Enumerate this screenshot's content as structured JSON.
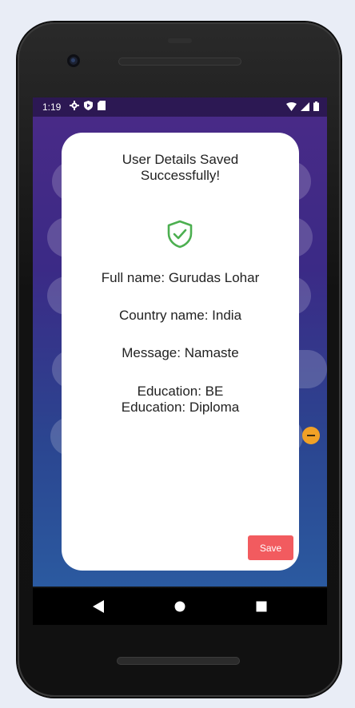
{
  "status_bar": {
    "time": "1:19",
    "icons_left": [
      "settings-icon",
      "shield-play-icon",
      "sd-card-icon"
    ],
    "icons_right": [
      "wifi-icon",
      "signal-icon",
      "battery-icon"
    ]
  },
  "dialog": {
    "title": "User Details Saved\nSuccessfully!",
    "icon": "shield-check-icon",
    "accent_color": "#4caf50",
    "full_name": "Full name: Gurudas Lohar",
    "country": "Country name: India",
    "message": "Message: Namaste",
    "education": [
      "Education: BE",
      "Education: Diploma"
    ],
    "save_label": "Save",
    "save_color": "#f25b5f"
  },
  "nav_bar": {
    "back": "back-icon",
    "home": "home-icon",
    "recents": "recents-icon"
  }
}
